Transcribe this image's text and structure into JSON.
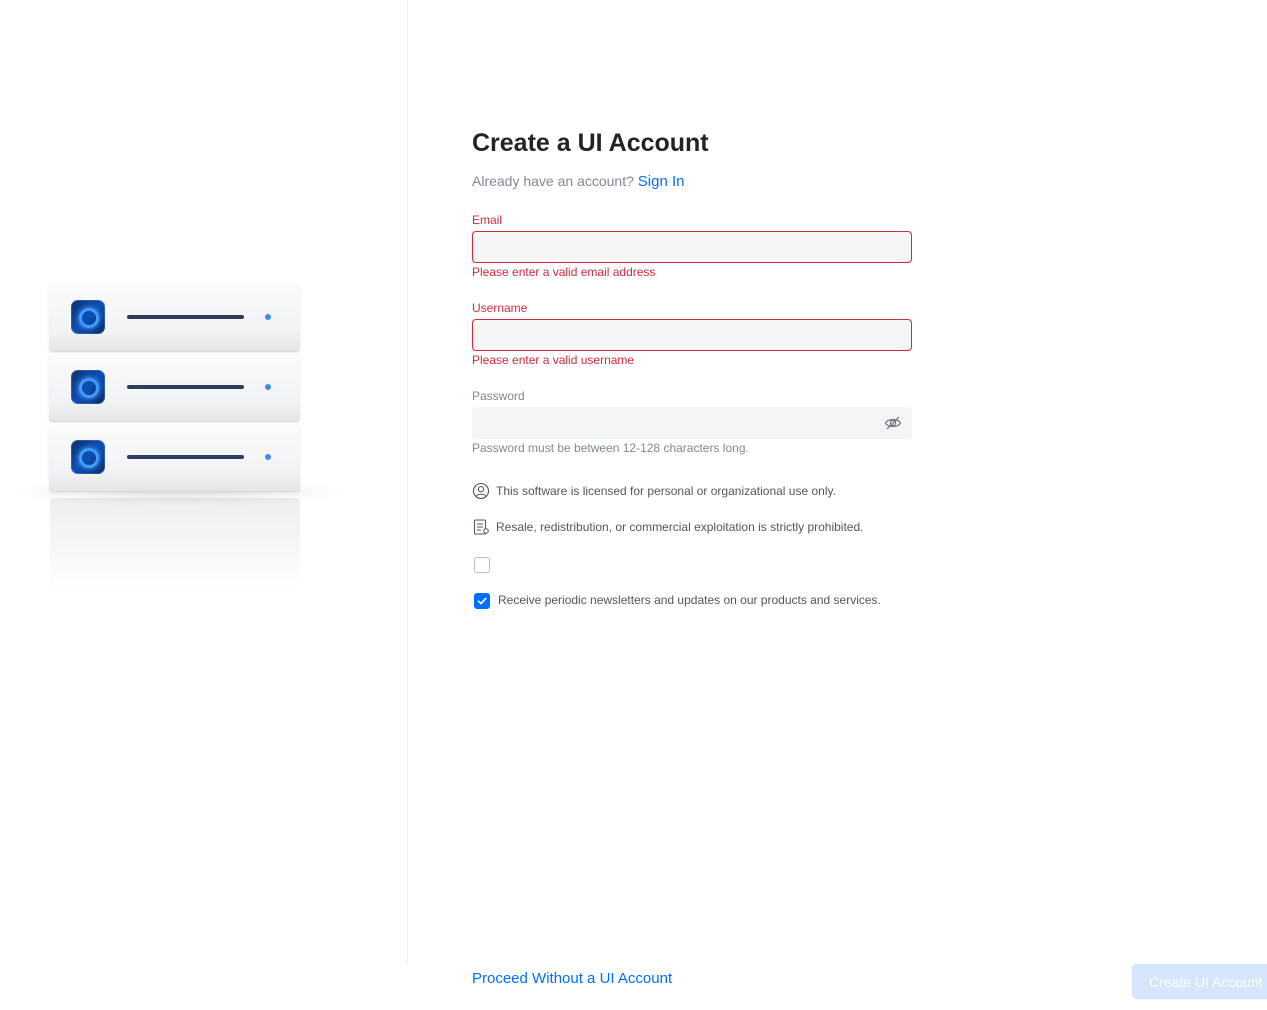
{
  "illustration": {
    "units": [
      "server-unit-1",
      "server-unit-2",
      "server-unit-3"
    ]
  },
  "form": {
    "title": "Create a UI Account",
    "already_text": "Already have an account?",
    "sign_in_label": "Sign In",
    "email": {
      "label": "Email",
      "value": "",
      "error": "Please enter a valid email address"
    },
    "username": {
      "label": "Username",
      "value": "",
      "error": "Please enter a valid username"
    },
    "password": {
      "label": "Password",
      "value": "",
      "helper": "Password must be between 12-128 characters long.",
      "toggle_icon": "eye-off-icon"
    },
    "notices": [
      {
        "icon": "user-circle-icon",
        "text": "This software is licensed for personal or organizational use only."
      },
      {
        "icon": "document-list-icon",
        "text": "Resale, redistribution, or commercial exploitation is strictly prohibited."
      }
    ],
    "checkboxes": [
      {
        "checked": false,
        "label": ""
      },
      {
        "checked": true,
        "label": "Receive periodic newsletters and updates on our products and services."
      }
    ]
  },
  "footer": {
    "proceed_label": "Proceed Without a UI Account",
    "create_label": "Create UI Account"
  },
  "colors": {
    "accent": "#006fff",
    "error": "#d02c3d",
    "muted": "#808893",
    "button_disabled_bg": "#d5e6fd"
  }
}
